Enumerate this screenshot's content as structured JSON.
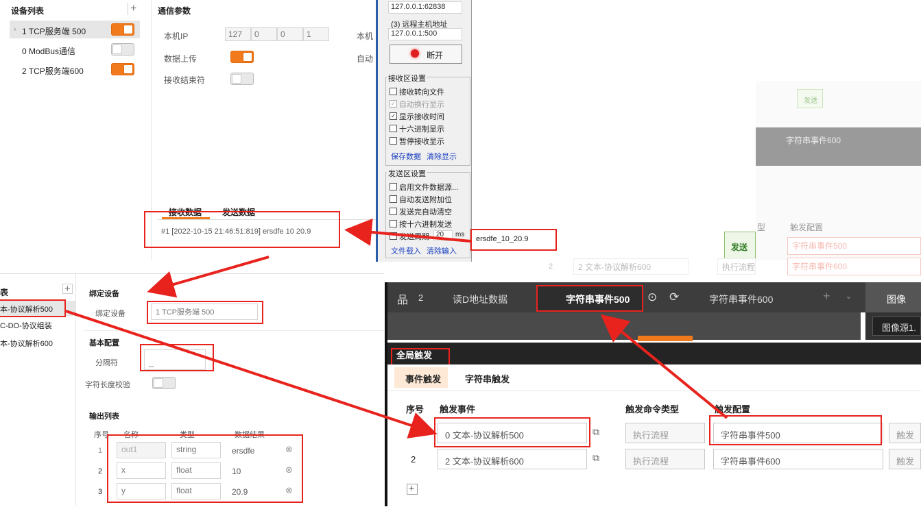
{
  "p1": {
    "device_list_title": "设备列表",
    "plus": "+",
    "devices": [
      {
        "label": "1 TCP服务端 500",
        "on": true
      },
      {
        "label": "0 ModBus通信",
        "on": false
      },
      {
        "label": "2 TCP服务端600",
        "on": true
      }
    ],
    "comm_params_title": "通信参数",
    "local_ip_label": "本机IP",
    "ip_octets": [
      "127",
      "0",
      "0",
      "1"
    ],
    "local_port_label": "本机",
    "data_upload_label": "数据上传",
    "auto_label": "自动",
    "recv_end_label": "接收结束符",
    "tabs": [
      "接收数据",
      "发送数据"
    ],
    "recv_line": "#1 [2022-10-15 21:46:51:819] ersdfe 10 20.9"
  },
  "p2": {
    "remote_ip_top": "127.0.0.1:62838",
    "remote_host_label": "(3) 远程主机地址",
    "remote_host_value": "127.0.0.1:500",
    "disconnect_label": "断开",
    "recv_settings_title": "接收区设置",
    "recv_options": [
      {
        "label": "接收转向文件",
        "checked": false,
        "disabled": false
      },
      {
        "label": "自动换行显示",
        "checked": true,
        "disabled": true
      },
      {
        "label": "显示接收时间",
        "checked": true,
        "disabled": false
      },
      {
        "label": "十六进制显示",
        "checked": false,
        "disabled": false
      },
      {
        "label": "暂停接收显示",
        "checked": false,
        "disabled": false
      }
    ],
    "recv_links": [
      "保存数据",
      "清除显示"
    ],
    "send_settings_title": "发送区设置",
    "send_options": [
      {
        "label": "启用文件数据源...",
        "checked": false
      },
      {
        "label": "自动发送附加位",
        "checked": false
      },
      {
        "label": "发送完自动清空",
        "checked": false
      },
      {
        "label": "按十六进制发送",
        "checked": false
      }
    ],
    "cycle_label": "发送周期",
    "cycle_value": "20",
    "cycle_unit": "ms",
    "send_links": [
      "文件载入",
      "清除输入"
    ],
    "send_box_value": "ersdfe_10_20.9",
    "send_button": "发送"
  },
  "p_ghost": {
    "send_btn": "发送",
    "event_tab": "字符串事件600",
    "col_type": "型",
    "col_trigger_config": "触发配置",
    "val1": "字符串事件500",
    "val2": "字符串事件600",
    "row2_no": "2",
    "row2_event": "2 文本-协议解析600",
    "row2_type": "执行流程"
  },
  "p3": {
    "left_col_title": "表",
    "plus": "+",
    "items": [
      "本-协议解析500",
      "C-DO-协议组装",
      "本-协议解析600"
    ],
    "bind_device_title": "绑定设备",
    "bind_device_label": "绑定设备",
    "bind_device_value": "1 TCP服务端 500",
    "basic_config_title": "基本配置",
    "separator_label": "分隔符",
    "separator_value": "_",
    "strlen_check_label": "字符长度校验",
    "output_list_title": "输出列表",
    "output_headers": [
      "序号",
      "名称",
      "类型",
      "数据结果"
    ],
    "output_rows": [
      {
        "no": "1",
        "name": "out1",
        "type": "string",
        "result": "ersdfe"
      },
      {
        "no": "2",
        "name": "x",
        "type": "float",
        "result": "10"
      },
      {
        "no": "3",
        "name": "y",
        "type": "float",
        "result": "20.9"
      }
    ]
  },
  "p4": {
    "tabs": [
      {
        "icon_num": "2",
        "label": "读D地址数据"
      },
      {
        "label": "字符串事件500"
      },
      {
        "label": "字符串事件600"
      }
    ],
    "plus": "+",
    "image_btn": "图像",
    "image_source": "图像源1.",
    "global_trigger_title": "全局触发",
    "subtabs": [
      "事件触发",
      "字符串触发"
    ],
    "headers": [
      "序号",
      "触发事件",
      "触发命令类型",
      "触发配置"
    ],
    "rows": [
      {
        "no": "1",
        "event": "0 文本-协议解析500",
        "cmd": "执行流程",
        "config": "字符串事件500",
        "extra": "触发"
      },
      {
        "no": "2",
        "event": "2 文本-协议解析600",
        "cmd": "执行流程",
        "config": "字符串事件600",
        "extra": "触发"
      }
    ],
    "add_symbol": "+"
  }
}
